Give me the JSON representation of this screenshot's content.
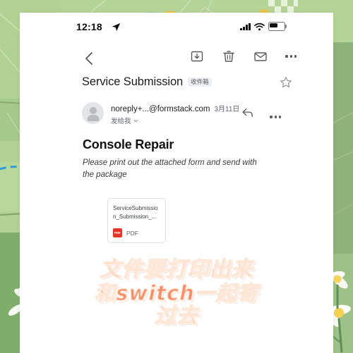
{
  "status_bar": {
    "time": "12:18",
    "location_icon": "location-arrow-icon",
    "signal_icon": "cellular-signal-icon",
    "wifi_icon": "wifi-icon",
    "battery_icon": "battery-half-icon"
  },
  "toolbar": {
    "back_icon": "chevron-left-icon",
    "archive_icon": "archive-box-down-arrow-icon",
    "delete_icon": "trash-can-icon",
    "mail_icon": "envelope-icon",
    "more_icon": "ellipsis-icon"
  },
  "email": {
    "subject": "Service Submission",
    "label": "收件箱",
    "star_icon": "star-outline-icon",
    "sender": "noreply+...@formstack.com",
    "date": "3月11日",
    "recipient": "发给我",
    "recipient_caret_icon": "chevron-down-icon",
    "avatar_icon": "person-avatar-icon",
    "reply_icon": "reply-arrow-icon",
    "more_icon": "ellipsis-icon",
    "body_title": "Console Repair",
    "body_text": "Please print out the attached form and send with the package"
  },
  "attachment": {
    "file_name": "ServiceSubmission_Submission_...",
    "file_type": "PDF",
    "badge_text": "PDF",
    "badge_color": "#e5352b"
  },
  "caption": {
    "line1": "文件要打印出来",
    "line2": "和switch一起寄",
    "line3": "过去",
    "color": "#f4916b"
  },
  "background": {
    "type": "grass-field-photo",
    "primary_color": "#a9cb8c",
    "checker_color": "#b6d398",
    "dashed_path_color": "#3aa7e0"
  }
}
